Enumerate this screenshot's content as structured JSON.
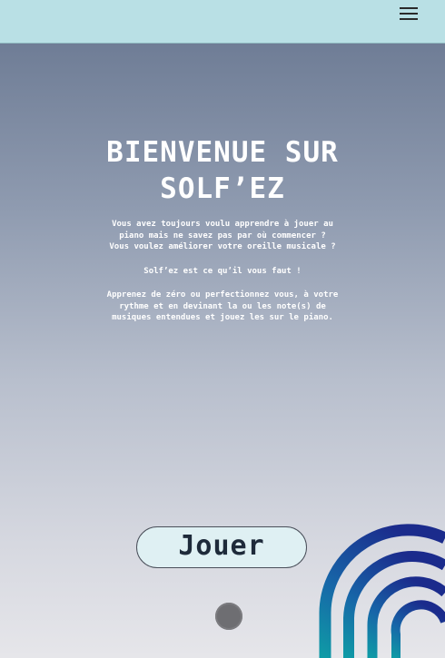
{
  "header": {
    "menu_icon": "hamburger-menu-icon"
  },
  "hero": {
    "title_line1": "BIENVENUE SUR",
    "title_line2": "SOLF’EZ",
    "paragraph1_line1": "Vous avez toujours voulu apprendre à jouer au",
    "paragraph1_line2": "piano mais ne savez pas par où commencer ?",
    "paragraph1_line3": "Vous voulez améliorer votre oreille musicale ?",
    "paragraph2": "Solf’ez est ce qu’il vous faut !",
    "paragraph3_line1": "Apprenez de zéro ou perfectionnez vous, à votre",
    "paragraph3_line2": "rythme et en devinant la ou les note(s) de",
    "paragraph3_line3": "musiques entendues et jouez les sur le piano."
  },
  "play_button": {
    "label": "Jouer"
  },
  "colors": {
    "header_bg": "#b9e0e5",
    "button_bg": "#dff0f3",
    "arc_blue": "#1b2f8f",
    "arc_teal": "#0f8fa0"
  }
}
